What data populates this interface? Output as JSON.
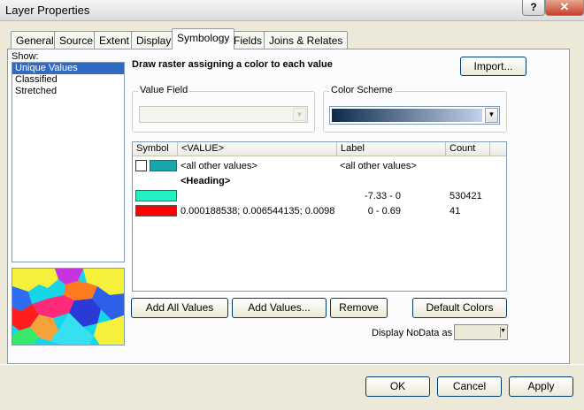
{
  "window": {
    "title": "Layer Properties",
    "help_label": "?",
    "close_label": "✕"
  },
  "tabs": [
    {
      "label": "General"
    },
    {
      "label": "Source"
    },
    {
      "label": "Extent"
    },
    {
      "label": "Display"
    },
    {
      "label": "Symbology",
      "active": true
    },
    {
      "label": "Fields"
    },
    {
      "label": "Joins & Relates"
    }
  ],
  "show": {
    "label": "Show:",
    "items": [
      {
        "label": "Unique Values",
        "selected": true
      },
      {
        "label": "Classified"
      },
      {
        "label": "Stretched"
      }
    ]
  },
  "description": "Draw raster assigning a color to each value",
  "import_button": "Import...",
  "value_field": {
    "label": "Value Field",
    "value": ""
  },
  "color_scheme": {
    "label": "Color Scheme",
    "colors": [
      "#0b2c4d",
      "#c4d1ea"
    ]
  },
  "table": {
    "headers": [
      "Symbol",
      "<VALUE>",
      "Label",
      "Count"
    ],
    "all_other": {
      "value": "<all other values>",
      "label": "<all other values>",
      "swatch": "#1aa7ab"
    },
    "heading": "<Heading>",
    "rows": [
      {
        "swatch": "#25f0c4",
        "value": "",
        "label": "-7.33 - 0",
        "count": "530421"
      },
      {
        "swatch": "#ff0000",
        "value": "0.000188538; 0.006544135; 0.0098",
        "label": "0 - 0.69",
        "count": "41"
      }
    ]
  },
  "buttons": {
    "add_all": "Add All Values",
    "add_values": "Add Values...",
    "remove": "Remove",
    "default_colors": "Default Colors"
  },
  "nodata": {
    "label": "Display NoData as"
  },
  "footer": {
    "ok": "OK",
    "cancel": "Cancel",
    "apply": "Apply"
  },
  "colors": {
    "selection": "#316ac5",
    "accent_border": "#003c74"
  }
}
